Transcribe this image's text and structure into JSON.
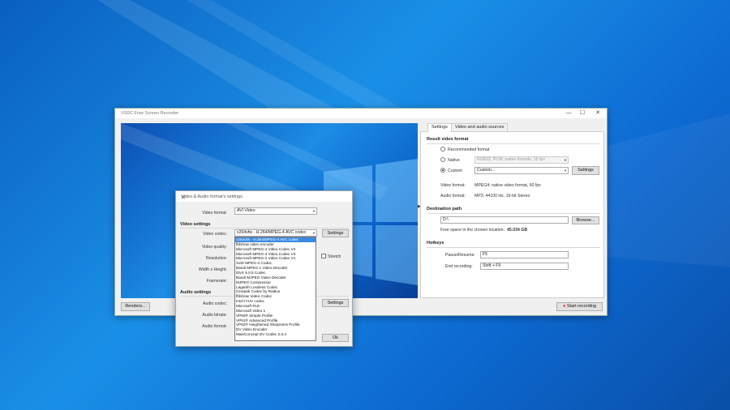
{
  "main_window": {
    "title": "VSDC Free Screen Recorder",
    "minimize": "—",
    "maximize": "☐",
    "close": "✕",
    "renders_button": "Renders...",
    "start_recording_button": "Start recording",
    "tabs": [
      "Settings",
      "Video and audio sources"
    ],
    "result_video_format": {
      "heading": "Result video format",
      "recommended_label": "Recommended format",
      "native_label": "Native",
      "native_value": "RGB32, PCM; native formats, 15 fps",
      "custom_label": "Custom",
      "custom_value": "Custom...",
      "settings_button": "Settings",
      "video_format_label": "Video format:",
      "video_format_value": "MPEG4; native video format, 60 fps",
      "audio_format_label": "Audio format:",
      "audio_format_value": "MP3; 44100 Hz, 16-bit Stereo"
    },
    "destination": {
      "heading": "Destination path",
      "path_value": "D:\\",
      "browse_button": "Browse...",
      "free_space_label": "Free space in the chosen location:",
      "free_space_value": "45.034 GB"
    },
    "hotkeys": {
      "heading": "Hotkeys",
      "pause_label": "Pause/Resume:",
      "pause_value": "F5",
      "end_label": "End recording:",
      "end_value": "Shift + F5"
    }
  },
  "dialog": {
    "title": "Video & Audio format's settings",
    "close": "✕",
    "video_format_label": "Video format:",
    "video_format_value": "AVI Video",
    "video_settings_heading": "Video settings",
    "video_codec_label": "Video codec:",
    "video_codec_value": "x264vfw - H.264/MPEG-4 AVC codec",
    "video_settings_button": "Settings",
    "video_quality_label": "Video quality:",
    "resolution_label": "Resolution:",
    "stretch_label": "Stretch",
    "width_height_label": "Width x Height:",
    "framerate_label": "Framerate:",
    "audio_settings_heading": "Audio settings",
    "audio_codec_label": "Audio codec:",
    "audio_settings_button": "Settings",
    "audio_bitrate_label": "Audio bitrate:",
    "audio_format_label": "Audio format:",
    "ok_button": "Ok",
    "codec_options": [
      "x264vfw - H.264/MPEG-4 AVC codec",
      "ffdshow video encoder",
      "Microsoft MPEG-4 Video Codec V2",
      "Microsoft MPEG-4 Video Codec V3",
      "Microsoft MPEG-4 Video Codec V1",
      "XviD MPEG-4 Codec",
      "Bandi MPEG-1 Video Decoder",
      "DivX 5.0.5 Codec",
      "Bandi MJPEG Video Decoder",
      "MJPEG Compressor",
      "Lagarith Lossless Codec",
      "Cinepak Codec by Radius",
      "ffdshow Video Codec",
      "Intel IYUV codec",
      "Microsoft RLE",
      "Microsoft Video 1",
      "VP60® Simple Profile",
      "VP61® Advanced Profile",
      "VP62® Heightened Sharpness Profile",
      "DV Video Encoder",
      "MainConcept DV Codec 2.0.4"
    ],
    "selected_codec_index": 0
  }
}
